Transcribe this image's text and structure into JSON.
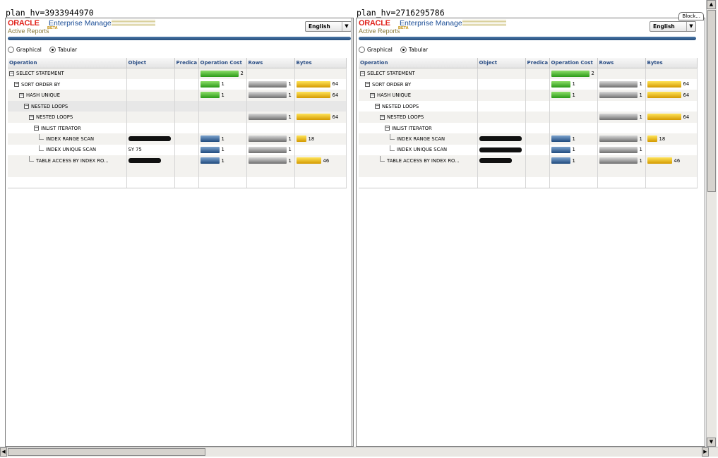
{
  "panels": [
    {
      "plan_hv": "plan_hv=3933944970",
      "block_tab": "",
      "brand": {
        "oracle": "ORACLE",
        "em": "Enterprise Manager",
        "active_reports": "Active Reports",
        "beta": "BETA"
      },
      "language": {
        "selected": "English"
      },
      "view": {
        "graphical": "Graphical",
        "tabular": "Tabular",
        "selected": "tabular"
      },
      "columns": [
        "Operation",
        "Object",
        "Predica",
        "Operation Cost",
        "Rows",
        "Bytes"
      ],
      "rows": [
        {
          "indent": 0,
          "expander": "minus",
          "operation": "SELECT STATEMENT",
          "object": "",
          "cost": 2,
          "rows": null,
          "bytes": null
        },
        {
          "indent": 1,
          "expander": "minus",
          "operation": "SORT ORDER BY",
          "object": "",
          "cost": 1,
          "rows": 1,
          "bytes": 64
        },
        {
          "indent": 2,
          "expander": "minus",
          "operation": "HASH UNIQUE",
          "object": "",
          "cost": 1,
          "rows": 1,
          "bytes": 64
        },
        {
          "indent": 3,
          "expander": "minus",
          "operation": "NESTED LOOPS",
          "object": "",
          "cost": null,
          "rows": null,
          "bytes": null
        },
        {
          "indent": 4,
          "expander": "minus",
          "operation": "NESTED LOOPS",
          "object": "",
          "cost": null,
          "rows": 1,
          "bytes": 64
        },
        {
          "indent": 5,
          "expander": "minus",
          "operation": "INLIST ITERATOR",
          "object": "",
          "cost": null,
          "rows": null,
          "bytes": null
        },
        {
          "indent": 6,
          "expander": "leaf",
          "operation": "INDEX RANGE SCAN",
          "object": "",
          "cost": 1,
          "rows": 1,
          "bytes": 18
        },
        {
          "indent": 6,
          "expander": "none",
          "operation": "INDEX UNIQUE SCAN",
          "object": "SY 75",
          "cost": 1,
          "rows": 1,
          "bytes": null
        },
        {
          "indent": 4,
          "expander": "leaf",
          "operation": "TABLE ACCESS BY INDEX RO...",
          "object": "",
          "cost": 1,
          "rows": 1,
          "bytes": 46
        }
      ]
    },
    {
      "plan_hv": "plan_hv=2716295786",
      "block_tab": "Block...",
      "brand": {
        "oracle": "ORACLE",
        "em": "Enterprise Manager",
        "active_reports": "Active Reports",
        "beta": "BETA"
      },
      "language": {
        "selected": "English"
      },
      "view": {
        "graphical": "Graphical",
        "tabular": "Tabular",
        "selected": "tabular"
      },
      "columns": [
        "Operation",
        "Object",
        "Predica",
        "Operation Cost",
        "Rows",
        "Bytes"
      ],
      "rows": [
        {
          "indent": 0,
          "expander": "minus",
          "operation": "SELECT STATEMENT",
          "object": "",
          "cost": 2,
          "rows": null,
          "bytes": null
        },
        {
          "indent": 1,
          "expander": "minus",
          "operation": "SORT ORDER BY",
          "object": "",
          "cost": 1,
          "rows": 1,
          "bytes": 64
        },
        {
          "indent": 2,
          "expander": "minus",
          "operation": "HASH UNIQUE",
          "object": "",
          "cost": 1,
          "rows": 1,
          "bytes": 64
        },
        {
          "indent": 3,
          "expander": "minus",
          "operation": "NESTED LOOPS",
          "object": "",
          "cost": null,
          "rows": null,
          "bytes": null
        },
        {
          "indent": 4,
          "expander": "minus",
          "operation": "NESTED LOOPS",
          "object": "",
          "cost": null,
          "rows": 1,
          "bytes": 64
        },
        {
          "indent": 5,
          "expander": "minus",
          "operation": "INLIST ITERATOR",
          "object": "",
          "cost": null,
          "rows": null,
          "bytes": null
        },
        {
          "indent": 6,
          "expander": "leaf",
          "operation": "INDEX RANGE SCAN",
          "object": "",
          "cost": 1,
          "rows": 1,
          "bytes": 18
        },
        {
          "indent": 6,
          "expander": "none",
          "operation": "INDEX UNIQUE SCAN",
          "object": "",
          "cost": 1,
          "rows": 1,
          "bytes": null
        },
        {
          "indent": 4,
          "expander": "leaf",
          "operation": "TABLE ACCESS BY INDEX RO...",
          "object": "",
          "cost": 1,
          "rows": 1,
          "bytes": 46
        }
      ]
    }
  ],
  "colors": {
    "oracle_red": "#e0211a",
    "em_blue": "#1a4d96",
    "cost_green": "#2a9a17",
    "rows_gray": "#6f6f6f",
    "bytes_gold": "#d49a00",
    "io_blue": "#1f4a7d"
  }
}
